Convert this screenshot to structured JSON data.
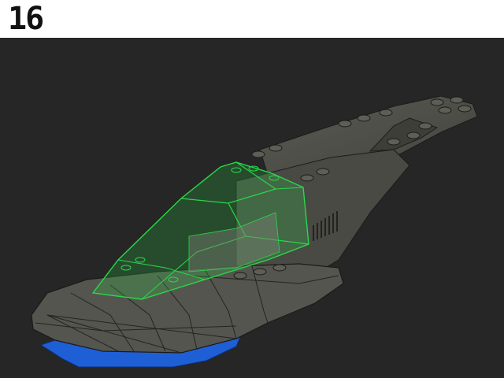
{
  "header": {
    "step_number": "16"
  },
  "scene": {
    "model": "spaceship",
    "background_color": "#262626",
    "hull_color": "#4e4e48",
    "canopy_color": "#2ad84a",
    "base_color": "#1f5fd6"
  }
}
